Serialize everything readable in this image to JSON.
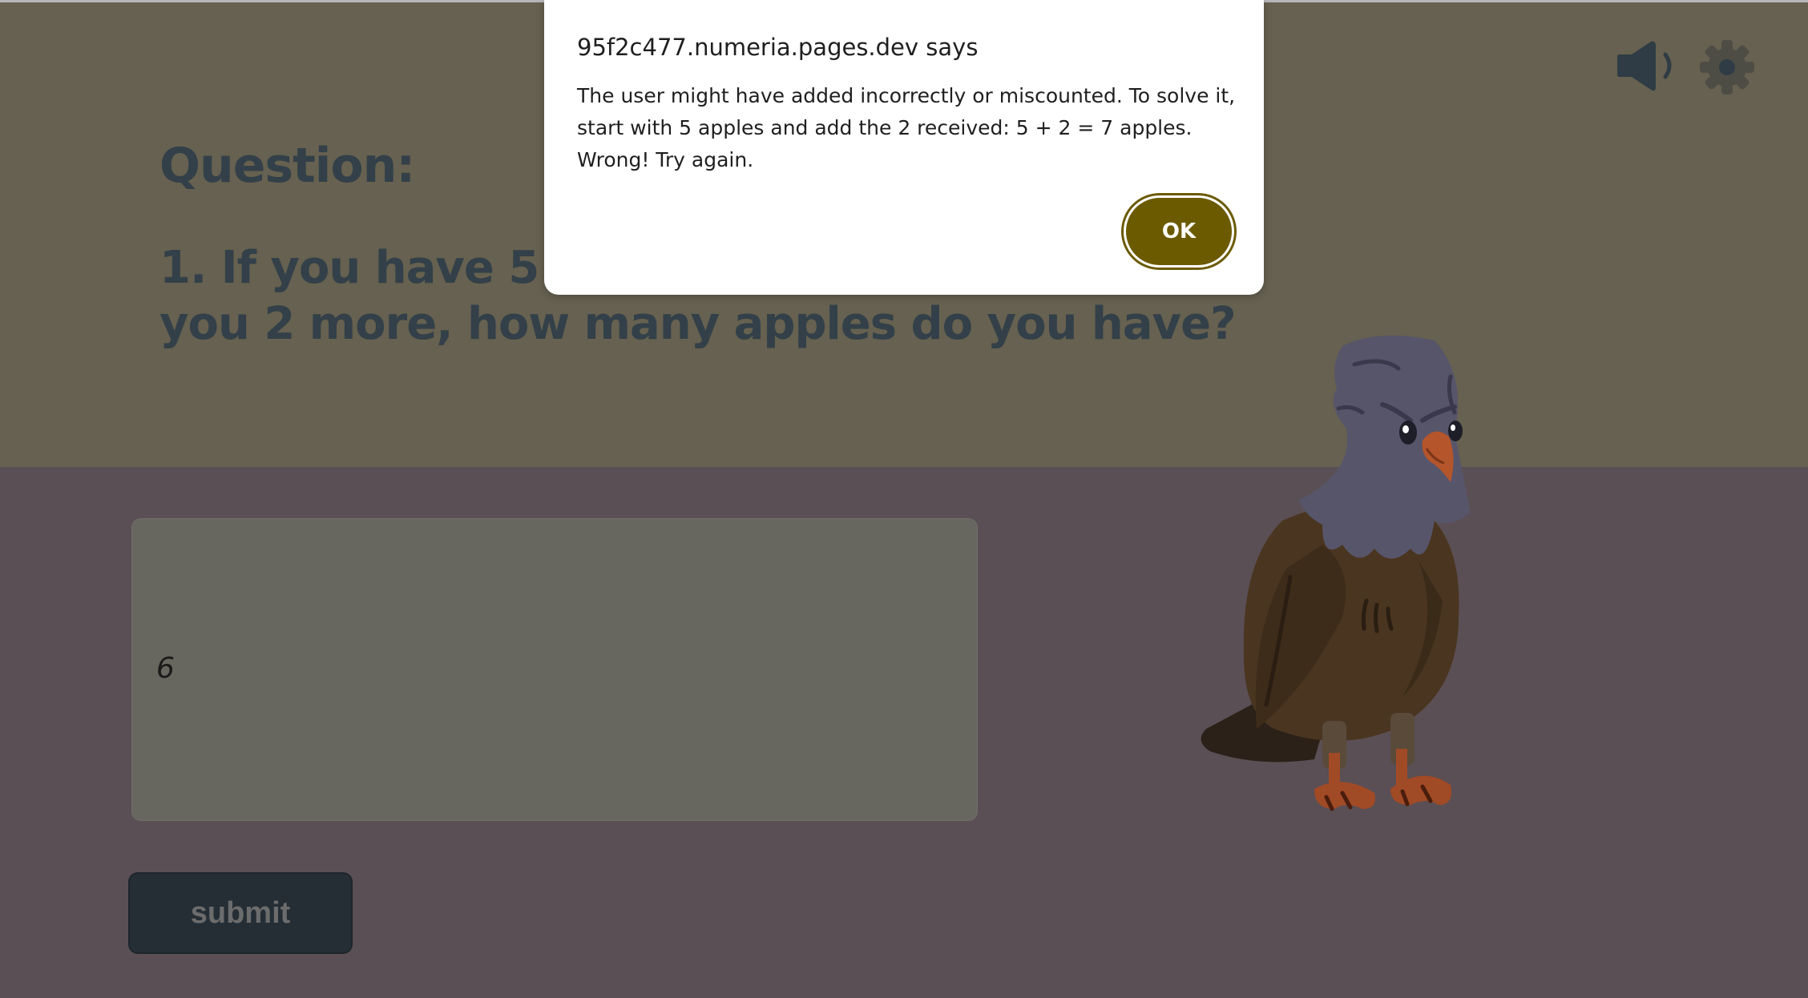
{
  "question": {
    "heading": "Question:",
    "text": "1. If you have 5 apples and someone gives you 2 more, how many apples do you have?"
  },
  "answer": {
    "value": "6"
  },
  "submit": {
    "label": "submit"
  },
  "dialog": {
    "title": "95f2c477.numeria.pages.dev says",
    "message": "The user might have added incorrectly or miscounted. To solve it, start with 5 apples and add the 2 received: 5 + 2 = 7 apples. Wrong! Try again.",
    "ok_label": "OK"
  },
  "icons": {
    "sound": "speaker-icon",
    "settings": "gear-icon",
    "character": "eagle-illustration"
  },
  "colors": {
    "top_panel": "#666150",
    "bottom_panel": "#5a4f54",
    "question_text": "#334049",
    "submit_bg": "#252e35",
    "ok_button": "#6b5a00"
  }
}
